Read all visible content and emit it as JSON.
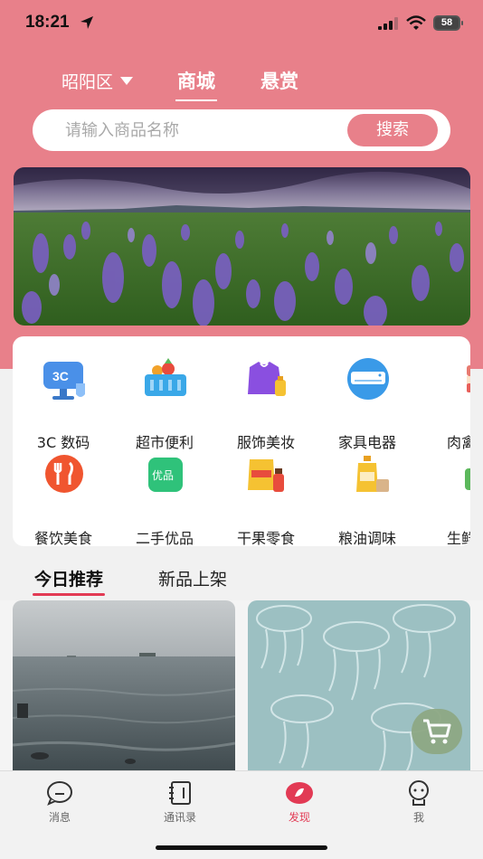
{
  "status_bar": {
    "time": "18:21",
    "battery": "58"
  },
  "header": {
    "region": "昭阳区",
    "tabs": [
      {
        "label": "商城",
        "active": true
      },
      {
        "label": "悬赏",
        "active": false
      }
    ]
  },
  "search": {
    "placeholder": "请输入商品名称",
    "button_label": "搜索"
  },
  "categories": [
    {
      "label": "3C 数码",
      "icon": "monitor-3c-icon"
    },
    {
      "label": "超市便利",
      "icon": "basket-icon"
    },
    {
      "label": "服饰美妆",
      "icon": "clothing-icon"
    },
    {
      "label": "家具电器",
      "icon": "air-conditioner-icon"
    },
    {
      "label": "肉禽蛋",
      "icon": "meat-icon"
    },
    {
      "label": "餐饮美食",
      "icon": "dining-icon"
    },
    {
      "label": "二手优品",
      "icon": "secondhand-icon"
    },
    {
      "label": "干果零食",
      "icon": "snacks-icon"
    },
    {
      "label": "粮油调味",
      "icon": "oil-icon"
    },
    {
      "label": "生鲜水",
      "icon": "fresh-basket-icon"
    }
  ],
  "recommend": {
    "tabs": [
      {
        "label": "今日推荐",
        "active": true
      },
      {
        "label": "新品上架",
        "active": false
      }
    ]
  },
  "tabbar": {
    "items": [
      {
        "label": "消息",
        "icon": "message-icon",
        "active": false
      },
      {
        "label": "通讯录",
        "icon": "contacts-icon",
        "active": false
      },
      {
        "label": "发现",
        "icon": "discover-icon",
        "active": true
      },
      {
        "label": "我",
        "icon": "profile-icon",
        "active": false
      }
    ]
  },
  "colors": {
    "brand": "#e8808a",
    "accent_red": "#e23a54"
  }
}
